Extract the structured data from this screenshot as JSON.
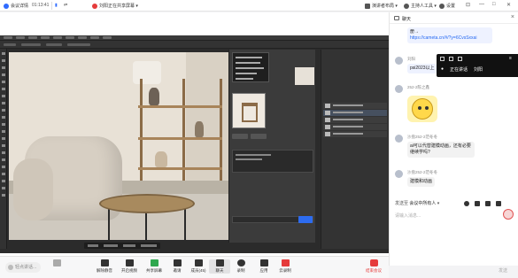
{
  "topbar": {
    "meeting_info": "会议详情",
    "meeting_time": "01:13:41",
    "sharing_title": "刘阳正在共享屏幕",
    "speaker_layout": "演讲者布局",
    "host_label": "主持人工具",
    "settings_label": "设置"
  },
  "chat": {
    "title": "聊天",
    "messages": [
      {
        "sender": "",
        "text_prefix": "册→",
        "link": "https://cameta.cn/#/?y=6CvsSxxai"
      },
      {
        "sender": "刘阳",
        "text": "psi2023以上"
      },
      {
        "sender": "252-2陈之鑫",
        "text": ""
      },
      {
        "sender": "沙盘252-2范冬冬",
        "text": "ai可以代替建模动画，还有必要继续学吗?"
      },
      {
        "sender": "沙盘252-2范冬冬",
        "text": "建模和动画"
      }
    ],
    "send_to_label": "发送至",
    "send_to_value": "会议中所有人",
    "input_placeholder": "请输入消息...",
    "send_button": "发送"
  },
  "float_bar": {
    "item1": "正在讲话",
    "item2": "刘阳"
  },
  "share_controls": {
    "resume": "取消",
    "zoom": "⊕"
  },
  "toolbar": {
    "speak_placeholder": "轻点讲话...",
    "items": [
      "解除静音",
      "开启视频",
      "共享屏幕",
      "邀请",
      "成员(45)",
      "聊天",
      "录制",
      "应用",
      "云录制",
      "应用"
    ],
    "end": "结束会议"
  }
}
